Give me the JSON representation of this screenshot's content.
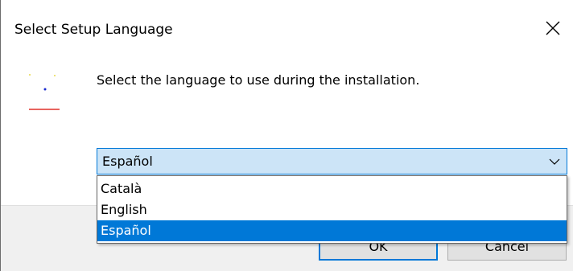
{
  "dialog": {
    "title": "Select Setup Language",
    "prompt": "Select the language to use during the installation."
  },
  "language_select": {
    "value": "Español",
    "options": [
      {
        "label": "Català",
        "selected": false
      },
      {
        "label": "English",
        "selected": false
      },
      {
        "label": "Español",
        "selected": true
      }
    ]
  },
  "buttons": {
    "ok_label": "OK",
    "cancel_label": "Cancel"
  },
  "icons": {
    "close": "close-icon",
    "app": "setup-app-icon",
    "dropdown": "chevron-down-icon"
  },
  "colors": {
    "accent": "#0078d7",
    "combo_background": "#cce4f7",
    "footer_background": "#f0f0f0"
  }
}
